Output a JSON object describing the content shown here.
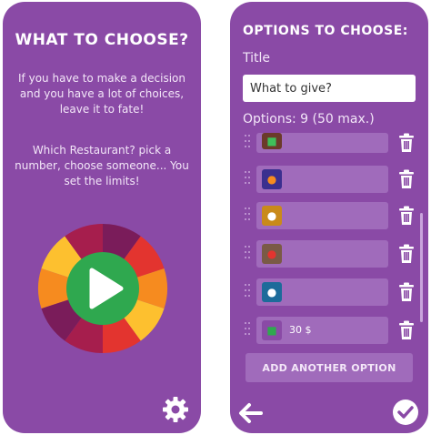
{
  "left": {
    "title": "WHAT TO CHOOSE?",
    "desc1": "If you have to make a decision and you have a lot of choices, leave it to fate!",
    "desc2": "Which Restaurant? pick a number, choose someone... You set the limits!",
    "wheel_colors": [
      "#7a1c5a",
      "#e3342f",
      "#f68b1f",
      "#fdc02f",
      "#e3342f",
      "#a61e4d",
      "#7a1c5a",
      "#f68b1f",
      "#fdc02f",
      "#a61e4d"
    ],
    "play_color": "#2fa84f",
    "play_icon": "play-icon",
    "settings_icon": "gear-icon"
  },
  "right": {
    "title": "OPTIONS TO CHOOSE:",
    "title_label": "Title",
    "title_value": "What to give?",
    "options_count": "Options: 9  (50 max.)",
    "options": [
      {
        "icon": "gift-box-icon",
        "value": ""
      },
      {
        "icon": "fruit-icon",
        "value": ""
      },
      {
        "icon": "teddy-icon",
        "value": ""
      },
      {
        "icon": "toy-icon",
        "value": ""
      },
      {
        "icon": "soccer-ball-icon",
        "value": ""
      },
      {
        "icon": "money-icon",
        "value": "30 $"
      }
    ],
    "add_button": "ADD ANOTHER OPTION",
    "back_icon": "back-arrow-icon",
    "confirm_icon": "check-icon"
  },
  "colors": {
    "background": "#8a4aa6",
    "row": "#a06bbb"
  }
}
